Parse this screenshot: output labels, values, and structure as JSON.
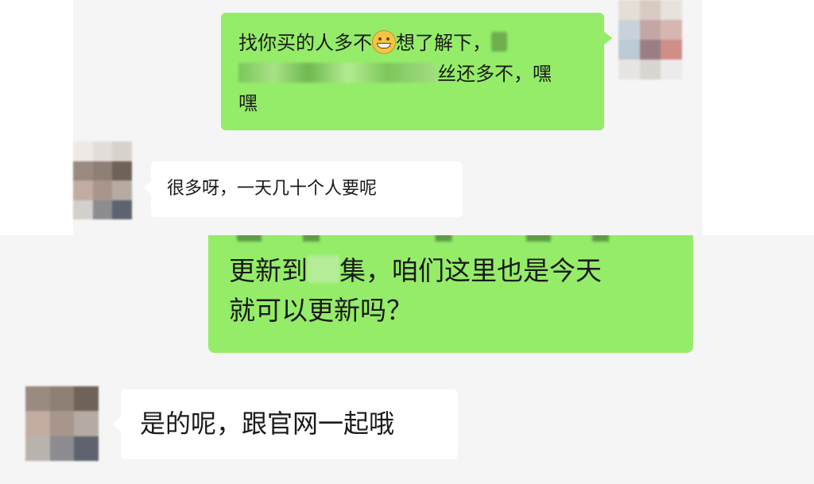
{
  "messages": [
    {
      "sender": "self",
      "line1_a": "找你买的人多不",
      "line1_b": "想了解下，",
      "line2_b": "丝还多不，嘿",
      "line3": "嘿"
    },
    {
      "sender": "contact",
      "text": "很多呀，一天几十个人要呢"
    },
    {
      "sender": "self",
      "line1_a": "更新到",
      "line1_b": "集，咱们这里也是今天",
      "line2": "就可以更新吗？"
    },
    {
      "sender": "contact",
      "text": "是的呢，跟官网一起哦"
    }
  ],
  "emoji": "grinning-face-icon",
  "colors": {
    "self_bubble": "#95ec69",
    "contact_bubble": "#ffffff",
    "chat_background": "#f5f5f5"
  }
}
